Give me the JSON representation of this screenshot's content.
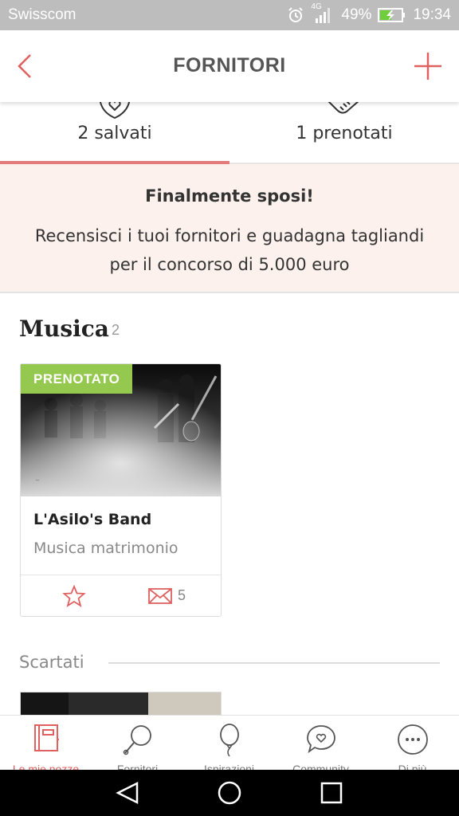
{
  "status_bar": {
    "carrier": "Swisscom",
    "network": "4G",
    "battery": "49%",
    "time": "19:34"
  },
  "header": {
    "title": "FORNITORI"
  },
  "tabs": [
    {
      "label": "2 salvati",
      "icon": "heart-shield-icon",
      "active": true
    },
    {
      "label": "1 prenotati",
      "icon": "handshake-icon",
      "active": false
    }
  ],
  "banner": {
    "title": "Finalmente sposi!",
    "text": "Recensisci i tuoi fornitori e guadagna tagliandi per il concorso di 5.000 euro"
  },
  "section": {
    "title": "Musica",
    "count": "2"
  },
  "card": {
    "badge": "PRENOTATO",
    "name": "L'Asilo's Band",
    "category": "Musica matrimonio",
    "message_count": "5"
  },
  "discarded": {
    "label": "Scartati"
  },
  "bottom_nav": [
    {
      "label": "Le mie nozze",
      "icon": "planner-book-icon",
      "active": true
    },
    {
      "label": "Fornitori",
      "icon": "search-magnifier-icon",
      "active": false
    },
    {
      "label": "Ispirazioni",
      "icon": "balloon-icon",
      "active": false
    },
    {
      "label": "Community",
      "icon": "chat-heart-icon",
      "active": false
    },
    {
      "label": "Di più",
      "icon": "more-dots-icon",
      "active": false
    }
  ],
  "colors": {
    "accent": "#e06060",
    "badge": "#95c84e",
    "banner_bg": "#fcf1ec"
  }
}
